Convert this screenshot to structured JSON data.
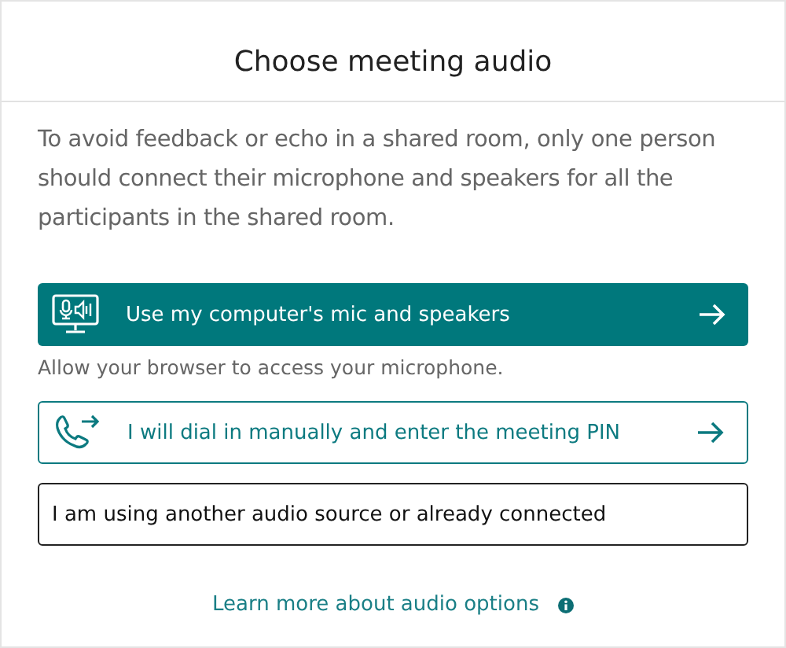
{
  "title": "Choose meeting audio",
  "description": "To avoid feedback or echo in a shared room, only one person should connect their microphone and speakers for all the participants in the shared room.",
  "options": [
    {
      "kind": "primary",
      "label": "Use my computer's mic and speakers",
      "hint": "Allow your browser to access your microphone."
    },
    {
      "kind": "outline",
      "label": "I will dial in manually and enter the meeting PIN"
    },
    {
      "kind": "plain",
      "label": "I am using another audio source or already connected"
    }
  ],
  "learn_more_link": "Learn more about audio options"
}
